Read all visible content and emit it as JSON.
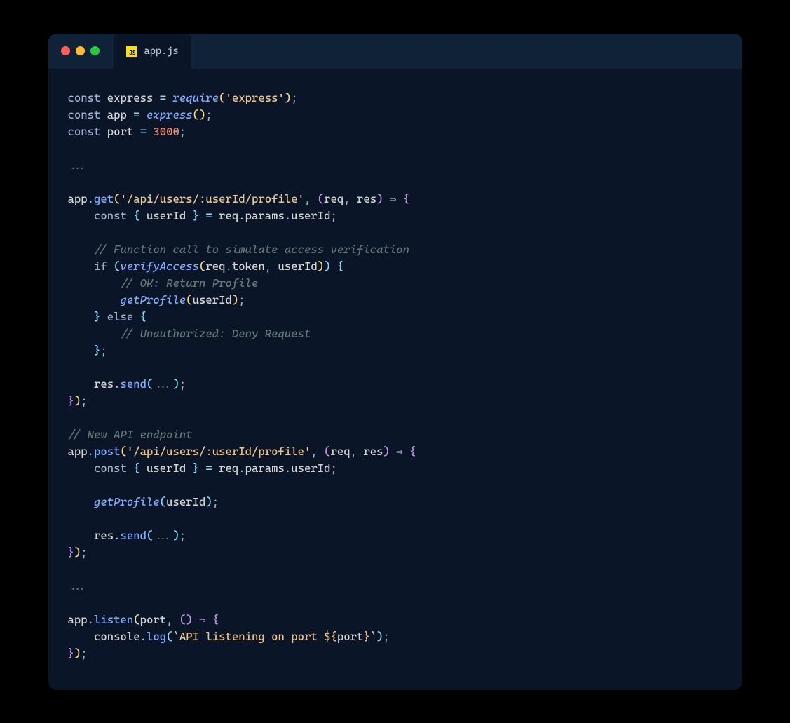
{
  "tab": {
    "filename": "app.js",
    "file_ext": "JS"
  },
  "code": {
    "k_const": "const",
    "k_if": "if",
    "k_else": "else",
    "v_express": "express",
    "v_app": "app",
    "v_port": "port",
    "v_req": "req",
    "v_res": "res",
    "v_userId": "userId",
    "v_params": "params",
    "v_token": "token",
    "v_console": "console",
    "fn_require": "require",
    "fn_verifyAccess": "verifyAccess",
    "fn_getProfile": "getProfile",
    "m_get": "get",
    "m_post": "post",
    "m_send": "send",
    "m_listen": "listen",
    "m_log": "log",
    "s_express": "'express'",
    "s_route": "'/api/users/:userId/profile'",
    "n_3000": "3000",
    "dots": "...",
    "arrow": "⇒",
    "c1": "// Function call to simulate access verification",
    "c2": "// OK: Return Profile",
    "c3": "// Unauthorized: Deny Request",
    "c4": "// New API endpoint",
    "tpl_open": "`",
    "tpl_text": "API listening on port ",
    "tpl_expr_open": "${",
    "tpl_expr_close": "}",
    "tpl_close": "`"
  }
}
